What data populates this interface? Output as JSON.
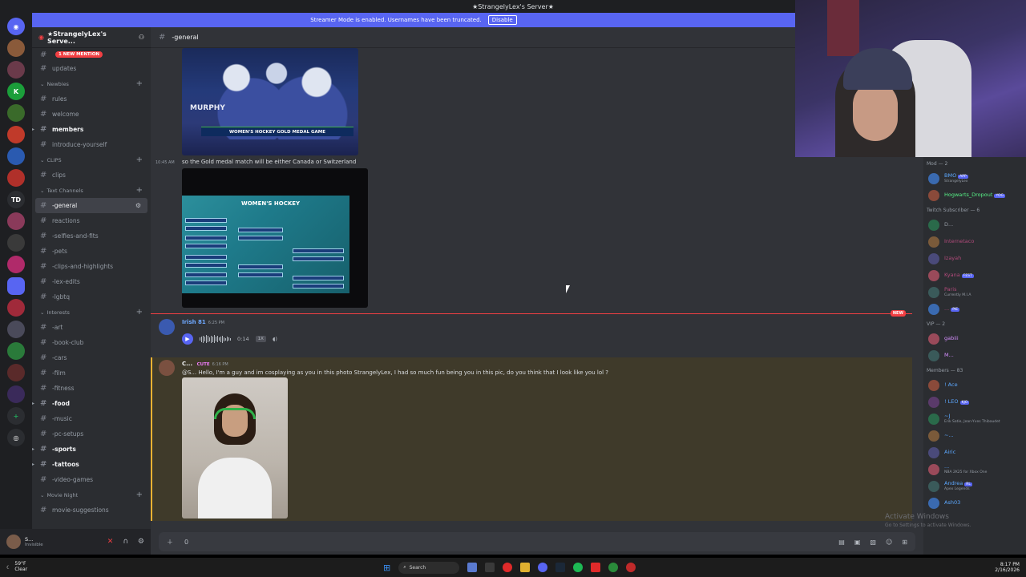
{
  "window_title": "★StrangelyLex's Server★",
  "banner": {
    "text": "Streamer Mode is enabled. Usernames have been truncated.",
    "button": "Disable"
  },
  "server": {
    "name": "★StrangelyLex's Serve...",
    "mention_badge": "1 NEW MENTION"
  },
  "channels": [
    {
      "type": "channel",
      "label": "updates"
    },
    {
      "type": "category",
      "label": "Newbies"
    },
    {
      "type": "channel",
      "label": "rules"
    },
    {
      "type": "channel",
      "label": "welcome"
    },
    {
      "type": "channel",
      "label": "members",
      "bold": true
    },
    {
      "type": "channel",
      "label": "introduce-yourself"
    },
    {
      "type": "category",
      "label": "CLIPS"
    },
    {
      "type": "channel",
      "label": "clips"
    },
    {
      "type": "category",
      "label": "Text Channels"
    },
    {
      "type": "channel",
      "label": "-general",
      "selected": true
    },
    {
      "type": "channel",
      "label": "reactions"
    },
    {
      "type": "channel",
      "label": "-selfies-and-fits"
    },
    {
      "type": "channel",
      "label": "-pets"
    },
    {
      "type": "channel",
      "label": "-clips-and-highlights"
    },
    {
      "type": "channel",
      "label": "-lex-edits"
    },
    {
      "type": "channel",
      "label": "-lgbtq"
    },
    {
      "type": "category",
      "label": "Interests"
    },
    {
      "type": "channel",
      "label": "-art"
    },
    {
      "type": "channel",
      "label": "-book-club"
    },
    {
      "type": "channel",
      "label": "-cars"
    },
    {
      "type": "channel",
      "label": "-film"
    },
    {
      "type": "channel",
      "label": "-fitness"
    },
    {
      "type": "channel",
      "label": "-food",
      "bold": true
    },
    {
      "type": "channel",
      "label": "-music"
    },
    {
      "type": "channel",
      "label": "-pc-setups"
    },
    {
      "type": "channel",
      "label": "-sports",
      "bold": true
    },
    {
      "type": "channel",
      "label": "-tattoos",
      "bold": true
    },
    {
      "type": "channel",
      "label": "-video-games"
    },
    {
      "type": "category",
      "label": "Movie Night"
    },
    {
      "type": "channel",
      "label": "movie-suggestions"
    }
  ],
  "user_panel": {
    "name": "S...",
    "status": "Invisible"
  },
  "chat": {
    "channel_name": "-general",
    "image1": {
      "player_name": "MURPHY",
      "chyron": "WOMEN'S HOCKEY GOLD MEDAL GAME"
    },
    "msg1": {
      "time": "10:45 AM",
      "text": "so the Gold medal match will be either Canada or Switzerland"
    },
    "image2": {
      "title": "WOMEN'S HOCKEY"
    },
    "new_tag": "NEW",
    "msg2": {
      "author": "Irish 81",
      "time": "6:25 PM",
      "duration": "0:14",
      "speed": "1X"
    },
    "msg3": {
      "author": "C...",
      "role": "CUTE",
      "time": "6:16 PM",
      "text": "@S... Hello, I'm a guy and im cosplaying as you in this photo StrangelyLex, I had so much fun being you in this pic, do you think that I look like you lol ?"
    },
    "input_value": "0"
  },
  "members": {
    "sections": [
      {
        "title": "Mod — 2",
        "items": [
          {
            "name": "BMO",
            "tag": "APP",
            "activity": "StrangelyLex",
            "color": "#5ca8ff"
          },
          {
            "name": "Hogwarts_Dropout",
            "tag": "YOG",
            "activity": "",
            "color": "#57f287"
          }
        ]
      },
      {
        "title": "Twitch Subscriber — 6",
        "items": [
          {
            "name": "D...",
            "activity": "",
            "color": "#949ba4"
          },
          {
            "name": "Internetaco",
            "activity": "",
            "color": "#b04a7a"
          },
          {
            "name": "Izayah",
            "activity": "",
            "color": "#b04a7a"
          },
          {
            "name": "Kyana",
            "tag": "FEST",
            "activity": "",
            "color": "#b04a7a"
          },
          {
            "name": "Paris",
            "activity": "Currently M.I.A",
            "color": "#b04a7a"
          },
          {
            "name": "...",
            "tag": "PIE",
            "activity": "",
            "color": "#b04a7a"
          }
        ]
      },
      {
        "title": "VIP — 2",
        "items": [
          {
            "name": "gabiii",
            "activity": "",
            "color": "#d68fff"
          },
          {
            "name": "M...",
            "activity": "",
            "color": "#d68fff"
          }
        ]
      },
      {
        "title": "Members — 83",
        "items": [
          {
            "name": "! Ace",
            "activity": "",
            "color": "#5ca8ff"
          },
          {
            "name": "! LEO",
            "tag": "KJO",
            "activity": "",
            "color": "#5ca8ff"
          },
          {
            "name": "~J",
            "activity": "Erik Satie, Jean-Yves Thibaudet",
            "color": "#5ca8ff"
          },
          {
            "name": "~...",
            "activity": "",
            "color": "#5ca8ff"
          },
          {
            "name": "Airic",
            "activity": "",
            "color": "#5ca8ff"
          },
          {
            "name": "...",
            "activity": "NBA 2K25 for Xbox One",
            "color": "#5ca8ff"
          },
          {
            "name": "Andrea",
            "tag": "RL",
            "activity": "Apex Legends",
            "color": "#5ca8ff"
          },
          {
            "name": "Ash03",
            "activity": "",
            "color": "#5ca8ff"
          }
        ]
      }
    ]
  },
  "watermark": {
    "title": "Activate Windows",
    "sub": "Go to Settings to activate Windows."
  },
  "taskbar": {
    "temp": "59°F",
    "cond": "Clear",
    "search": "Search",
    "time": "8:17 PM",
    "date": "2/16/2026"
  }
}
